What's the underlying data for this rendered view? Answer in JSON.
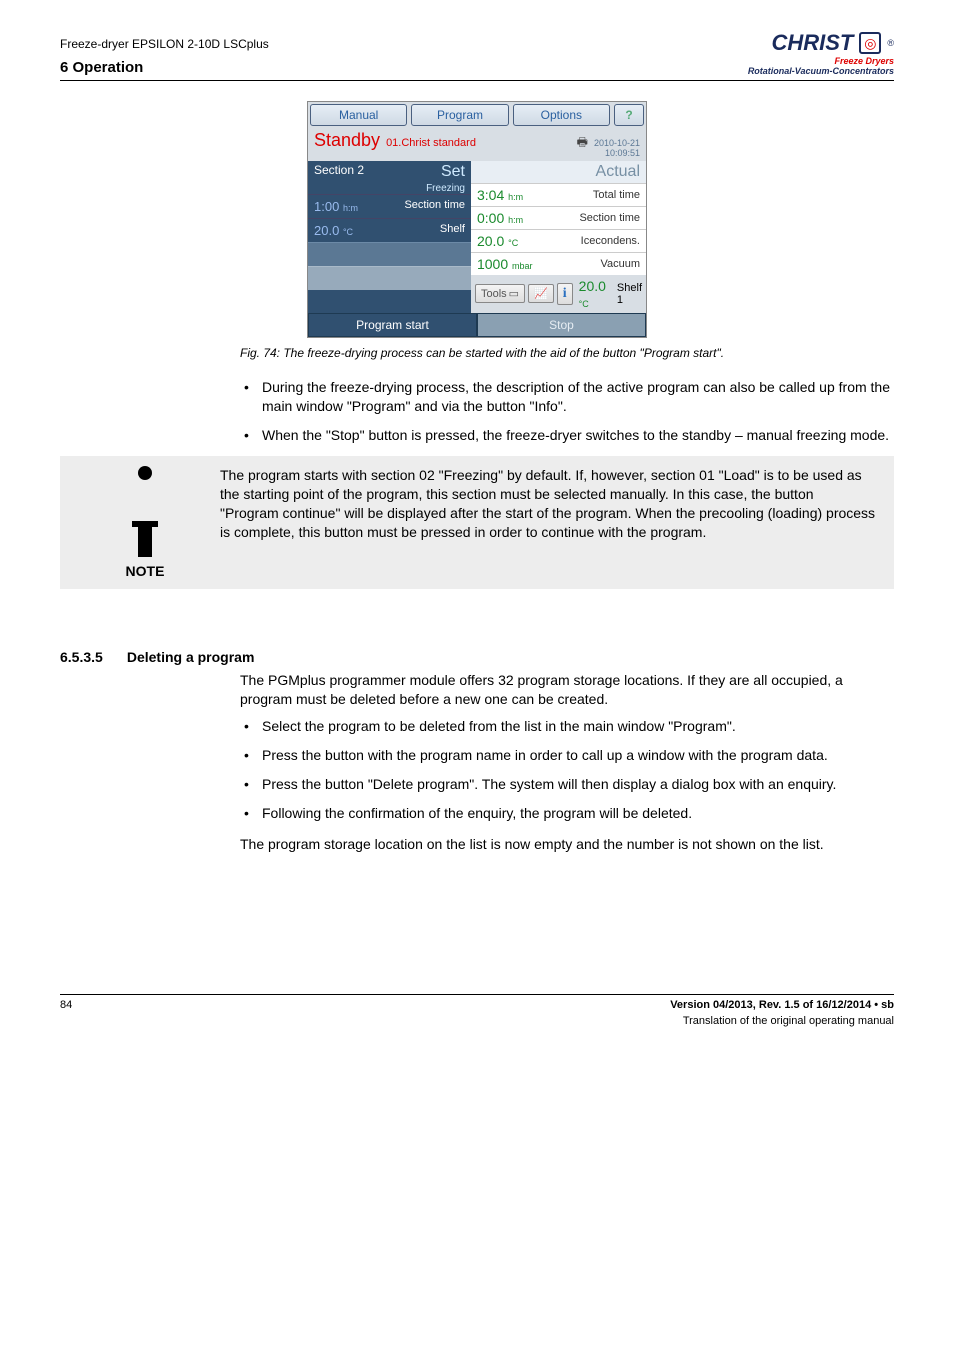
{
  "header": {
    "device": "Freeze-dryer EPSILON 2-10D LSCplus",
    "section": "6 Operation",
    "logo": {
      "brand": "CHRIST",
      "sub1": "Freeze Dryers",
      "sub2": "Rotational-Vacuum-Concentrators"
    }
  },
  "screenshot": {
    "tabs": {
      "manual": "Manual",
      "program": "Program",
      "options": "Options",
      "help": "?"
    },
    "standby": {
      "label": "Standby",
      "sub": "01.Christ standard",
      "date": "2010-10-21",
      "time": "10:09:51"
    },
    "set": {
      "section": "Section 2",
      "set_label": "Set",
      "freezing": "Freezing",
      "row1_val": "1:00",
      "row1_unit": "h:m",
      "row1_lbl": "Section time",
      "row2_val": "20.0",
      "row2_unit": "°C",
      "row2_lbl": "Shelf"
    },
    "actual": {
      "label": "Actual",
      "r1_val": "3:04",
      "r1_unit": "h:m",
      "r1_lbl": "Total time",
      "r2_val": "0:00",
      "r2_unit": "h:m",
      "r2_lbl": "Section time",
      "r3_val": "20.0",
      "r3_unit": "°C",
      "r3_lbl": "Icecondens.",
      "r4_val": "1000",
      "r4_unit": "mbar",
      "r4_lbl": "Vacuum",
      "r5_val": "20.0",
      "r5_unit": "°C",
      "r5_lbl": "Shelf 1"
    },
    "tools": {
      "label": "Tools"
    },
    "bottom": {
      "start": "Program start",
      "stop": "Stop"
    }
  },
  "fig_caption": "Fig. 74: The freeze-drying process can be started with the aid of the button \"Program start\".",
  "bullets1": [
    "During the freeze-drying process, the description of the active program can also be called up from the main window \"Program\" and via the button \"Info\".",
    "When the \"Stop\" button is pressed, the freeze-dryer switches to the standby – manual freezing mode."
  ],
  "note": {
    "label": "NOTE",
    "text": "The program starts with section 02 \"Freezing\" by default. If, however, section 01 \"Load\" is to be used as the starting point of the program, this section must be selected manually. In this case, the button \"Program continue\" will be displayed after the start of the program. When the precooling (loading) process is complete, this button must be pressed in order to continue with the program."
  },
  "subsection": {
    "num": "6.5.3.5",
    "title": "Deleting a program"
  },
  "para1": "The PGMplus programmer module offers 32 program storage locations. If they are all occupied, a program must be deleted before a new one can be created.",
  "bullets2": [
    "Select the program to be deleted from the list in the main window \"Program\".",
    "Press the button with the program name in order to call up a window with the program data.",
    "Press the button \"Delete program\". The system will then display a dialog box with an enquiry.",
    "Following the confirmation of the enquiry, the program will be deleted."
  ],
  "para2": "The program storage location on the list is now empty and the number is not shown on the list.",
  "footer": {
    "page": "84",
    "version": "Version 04/2013, Rev. 1.5 of 16/12/2014 • sb",
    "translation": "Translation of the original operating manual"
  }
}
